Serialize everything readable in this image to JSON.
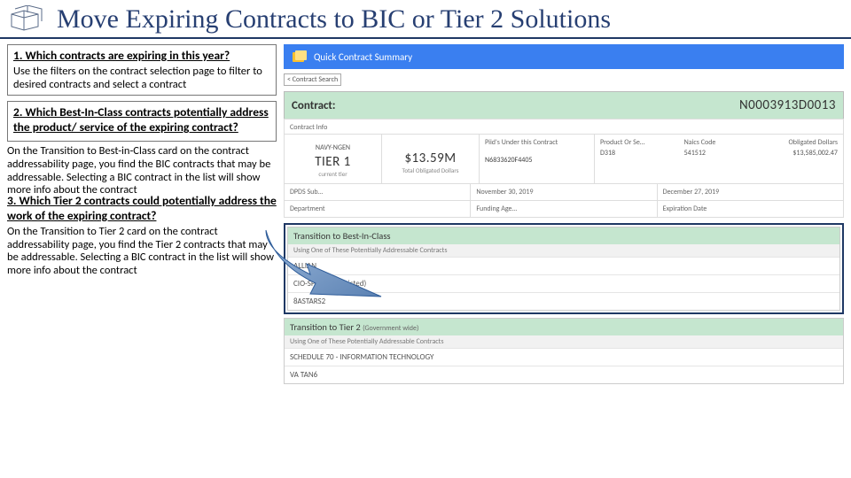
{
  "title": "Move Expiring Contracts to BIC or Tier 2 Solutions",
  "steps": {
    "s1": {
      "heading": "1. Which contracts are expiring in this year?",
      "body": "Use the filters on the contract selection page to filter to desired contracts and select a contract"
    },
    "s2": {
      "heading": "2. Which Best-In-Class contracts potentially address the product/ service of the expiring contract?",
      "body": "On the Transition to Best-in-Class card on the contract addressability page, you find the BIC contracts that may be addressable. Selecting a BIC contract in the list will show more info about the contract"
    },
    "s3": {
      "heading": "3. Which Tier 2 contracts could potentially address the work of the expiring contract?",
      "body": "On the Transition to Tier 2 card on the contract addressability page, you find the Tier 2 contracts that may be addressable. Selecting a BIC contract in the list will show more info about the contract"
    }
  },
  "qcs": {
    "bar_label": "Quick Contract Summary",
    "back": "< Contract Search",
    "contract_label": "Contract:",
    "contract_value": "N0003913D0013",
    "info_label": "Contract Info",
    "name": "NAVY-NGEN",
    "tier": "TIER 1",
    "tier_sub": "current tier",
    "obligated": "$13.59M",
    "obligated_sub": "Total Obligated Dollars",
    "piids_head": "Piid's Under this Contract",
    "piid_value": "N6833620F4405",
    "prod_cols": {
      "a": "Product Or Se…",
      "b": "Naics Code",
      "c": "Obligated Dollars"
    },
    "prod_row": {
      "a": "D318",
      "b": "541512",
      "c": "$13,585,002.47"
    },
    "dates": {
      "dpds_label": "DPDS Sub…",
      "effective": "November 30, 2019",
      "expiry": "December 27, 2019",
      "dept": "Department",
      "fund": "Funding Age…",
      "exp": "Expiration Date"
    },
    "bic": {
      "title": "Transition to Best-In-Class",
      "sub": "Using One of These Potentially Addressable Contracts",
      "items": [
        "ALLIAN",
        "CIO-SP3 (Unrestricted)",
        "8ASTARS2"
      ]
    },
    "tier2": {
      "title": "Transition to Tier 2",
      "gw": "(Government wide)",
      "sub": "Using One of These Potentially Addressable Contracts",
      "items": [
        "SCHEDULE 70 - INFORMATION TECHNOLOGY",
        "VA TAN6"
      ]
    }
  }
}
